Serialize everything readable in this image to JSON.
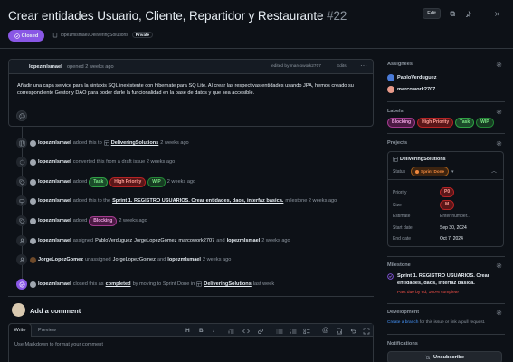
{
  "header": {
    "title": "Crear entidades Usuario, Cliente, Repartidor y Restaurante",
    "number": "#22",
    "edit_label": "Edit",
    "state_label": "Closed",
    "repo": "lopezmlsmael/DeliveringSolutions",
    "visibility": "Private"
  },
  "comment": {
    "author": "lopezmlsmael",
    "action": "opened 2 weeks ago",
    "edited_by": "edited by marcowork2707",
    "edits_label": "Edits",
    "body": "Añadir una capa service para la sintaxis SQL inexistente con hibernate para SQ Lite. Al crear las respectivas entidades usando JPA, hemos creado su correspondiente Gestor y DAO para poder darle la funcionalidad en la base de datos y que sea accesible."
  },
  "timeline": [
    {
      "icon": "project-icon",
      "user": "lopezmlsmael",
      "pre": "added this to",
      "link": "DeliveringSolutions",
      "post": "2 weeks ago"
    },
    {
      "icon": "draft-icon",
      "user": "lopezmlsmael",
      "pre": "converted this from a draft issue 2 weeks ago",
      "link": "",
      "post": ""
    },
    {
      "icon": "tag-icon",
      "user": "lopezmlsmael",
      "pre": "added",
      "labels": [
        "Task",
        "High Priority",
        "WIP"
      ],
      "post": "2 weeks ago"
    },
    {
      "icon": "milestone-icon",
      "user": "lopezmlsmael",
      "pre": "added this to the",
      "link": "Sprint 1. REGISTRO USUARIOS. Crear entidades, daos, interfaz basica.",
      "post": "milestone 2 weeks ago"
    },
    {
      "icon": "tag-icon",
      "user": "lopezmlsmael",
      "pre": "added",
      "labels": [
        "Blocking"
      ],
      "post": "2 weeks ago"
    },
    {
      "icon": "person-icon",
      "user": "lopezmlsmael",
      "pre": "assigned",
      "assignees": [
        "PabloVerduguez",
        "JorgeLopezGomez",
        "marcowork2707"
      ],
      "and": "and",
      "last": "lopezmlsmael",
      "post": "2 weeks ago"
    },
    {
      "icon": "person-icon",
      "user": "JorgeLopezGomez",
      "pre": "unassigned",
      "assignees": [
        "JorgeLopezGomez"
      ],
      "and": "and",
      "last": "lopezmlsmael",
      "post": "2 weeks ago"
    },
    {
      "icon": "closed-icon",
      "user": "lopezmlsmael",
      "pre": "closed this as",
      "link": "completed",
      "mid": "by moving to Sprint Done in",
      "link2": "DeliveringSolutions",
      "post": "last week"
    }
  ],
  "add_comment": {
    "title": "Add a comment",
    "tab_write": "Write",
    "tab_preview": "Preview",
    "placeholder": "Use Markdown to format your comment"
  },
  "sidebar": {
    "assignees_title": "Assignees",
    "assignees": [
      "PabloVerduguez",
      "marcowork2707"
    ],
    "labels_title": "Labels",
    "labels": [
      "Blocking",
      "High Priority",
      "Task",
      "WIP"
    ],
    "projects_title": "Projects",
    "project_name": "DeliveringSolutions",
    "status_key": "Status",
    "status_value": "Sprint Done",
    "fields": [
      {
        "k": "Priority",
        "v": "P0",
        "pill": true
      },
      {
        "k": "Size",
        "v": "M",
        "pill": true
      },
      {
        "k": "Estimate",
        "v": "Enter number...",
        "pill": false
      },
      {
        "k": "Start date",
        "v": "Sep 30, 2024",
        "pill": false
      },
      {
        "k": "End date",
        "v": "Oct 7, 2024",
        "pill": false
      }
    ],
    "milestone_title": "Milestone",
    "milestone_name": "Sprint 1. REGISTRO USUARIOS. Crear entidades, daos, interfaz basica.",
    "milestone_due": "Past due by 6d, 100% complete",
    "development_title": "Development",
    "development_link": "Create a branch",
    "development_text": "for this issue or link a pull request.",
    "notifications_title": "Notifications",
    "unsubscribe_label": "Unsubscribe"
  },
  "colors": {
    "accent_purple": "#8957e5",
    "label_task": "#238636",
    "label_high": "#b62324",
    "label_wip": "#1f6f3f",
    "label_blocking": "#a33b8f"
  }
}
